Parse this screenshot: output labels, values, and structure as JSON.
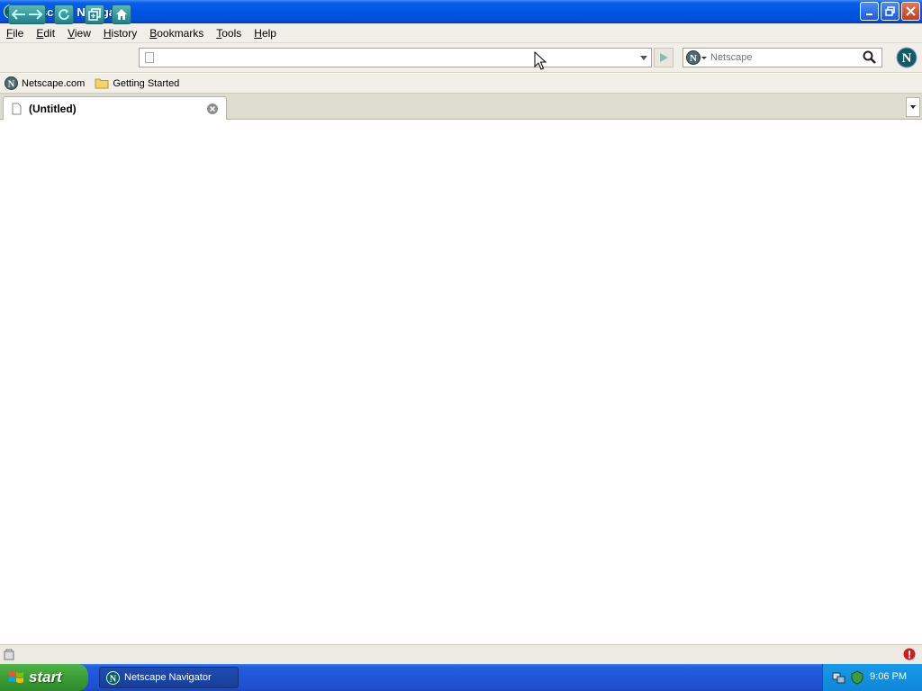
{
  "window": {
    "title": "Netscape Navigator",
    "controls": [
      "minimize",
      "restore",
      "close"
    ]
  },
  "menu": {
    "items": [
      {
        "label": "File",
        "accel": "F",
        "rest": "ile"
      },
      {
        "label": "Edit",
        "accel": "E",
        "rest": "dit"
      },
      {
        "label": "View",
        "accel": "V",
        "rest": "iew"
      },
      {
        "label": "History",
        "accel": "H",
        "rest": "istory"
      },
      {
        "label": "Bookmarks",
        "accel": "B",
        "rest": "ookmarks"
      },
      {
        "label": "Tools",
        "accel": "T",
        "rest": "ools"
      },
      {
        "label": "Help",
        "accel": "H",
        "rest": "elp"
      }
    ]
  },
  "navbar": {
    "address_value": "",
    "search_engine": "Netscape",
    "search_placeholder": "Netscape"
  },
  "bookmarks": [
    {
      "label": "Netscape.com",
      "icon": "netscape-icon"
    },
    {
      "label": "Getting Started",
      "icon": "folder-icon"
    }
  ],
  "tabs": [
    {
      "title": "(Untitled)",
      "active": true
    }
  ],
  "taskbar": {
    "start_label": "start",
    "tasks": [
      {
        "label": "Netscape Navigator"
      }
    ],
    "clock": "9:06 PM"
  },
  "colors": {
    "titlebar": "#0054e3",
    "toolbar_teal": "#227f86",
    "chrome_bg": "#f1efe8",
    "start_green": "#3c9f36"
  }
}
